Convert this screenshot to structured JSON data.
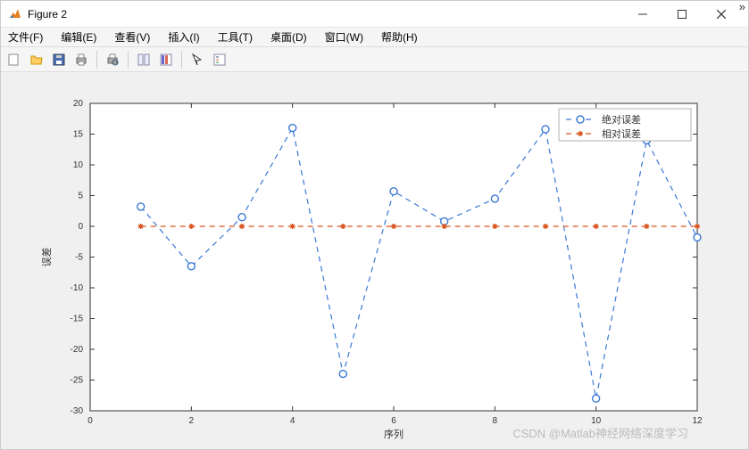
{
  "titlebar": {
    "title": "Figure 2"
  },
  "menu": {
    "file": "文件(F)",
    "edit": "编辑(E)",
    "view": "查看(V)",
    "insert": "插入(I)",
    "tools": "工具(T)",
    "desktop": "桌面(D)",
    "window": "窗口(W)",
    "help": "帮助(H)"
  },
  "chart_data": {
    "type": "line",
    "x": [
      1,
      2,
      3,
      4,
      5,
      6,
      7,
      8,
      9,
      10,
      11,
      12
    ],
    "series": [
      {
        "name": "绝对误差",
        "values": [
          3.2,
          -6.5,
          1.5,
          16,
          -24,
          5.7,
          0.8,
          4.5,
          15.8,
          -28,
          14,
          -1.8
        ]
      },
      {
        "name": "相对误差",
        "values": [
          0,
          0,
          0,
          0,
          0,
          0,
          0,
          0,
          0,
          0,
          0,
          0
        ]
      }
    ],
    "xlabel": "序列",
    "ylabel": "误差",
    "xlim": [
      0,
      12
    ],
    "ylim": [
      -30,
      20
    ],
    "xticks": [
      0,
      2,
      4,
      6,
      8,
      10,
      12
    ],
    "yticks": [
      -30,
      -25,
      -20,
      -15,
      -10,
      -5,
      0,
      5,
      10,
      15,
      20
    ]
  },
  "watermark": "CSDN @Matlab神经网络深度学习"
}
